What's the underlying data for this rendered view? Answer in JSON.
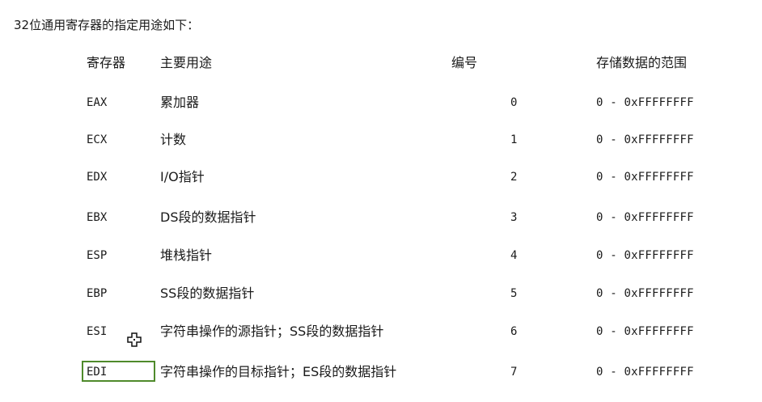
{
  "intro": "32位通用寄存器的指定用途如下：",
  "table": {
    "headers": {
      "register": "寄存器",
      "purpose": "主要用途",
      "number": "编号",
      "range": "存储数据的范围"
    },
    "rows": [
      {
        "register": "EAX",
        "purpose": "累加器",
        "number": "0",
        "range": "0 - 0xFFFFFFFF"
      },
      {
        "register": "ECX",
        "purpose": "计数",
        "number": "1",
        "range": "0 - 0xFFFFFFFF"
      },
      {
        "register": "EDX",
        "purpose": "I/O指针",
        "number": "2",
        "range": "0 - 0xFFFFFFFF"
      },
      {
        "register": "EBX",
        "purpose": "DS段的数据指针",
        "number": "3",
        "range": "0 - 0xFFFFFFFF"
      },
      {
        "register": "ESP",
        "purpose": "堆栈指针",
        "number": "4",
        "range": "0 - 0xFFFFFFFF"
      },
      {
        "register": "EBP",
        "purpose": "SS段的数据指针",
        "number": "5",
        "range": "0 - 0xFFFFFFFF"
      },
      {
        "register": "ESI",
        "purpose": "字符串操作的源指针；SS段的数据指针",
        "number": "6",
        "range": "0 - 0xFFFFFFFF"
      },
      {
        "register": "EDI",
        "purpose": "字符串操作的目标指针；ES段的数据指针",
        "number": "7",
        "range": "0 - 0xFFFFFFFF"
      }
    ]
  },
  "selection": {
    "row": "EDI",
    "border_color": "#4f8a2b"
  },
  "cursor": {
    "icon": "move-cross-cursor-icon"
  }
}
